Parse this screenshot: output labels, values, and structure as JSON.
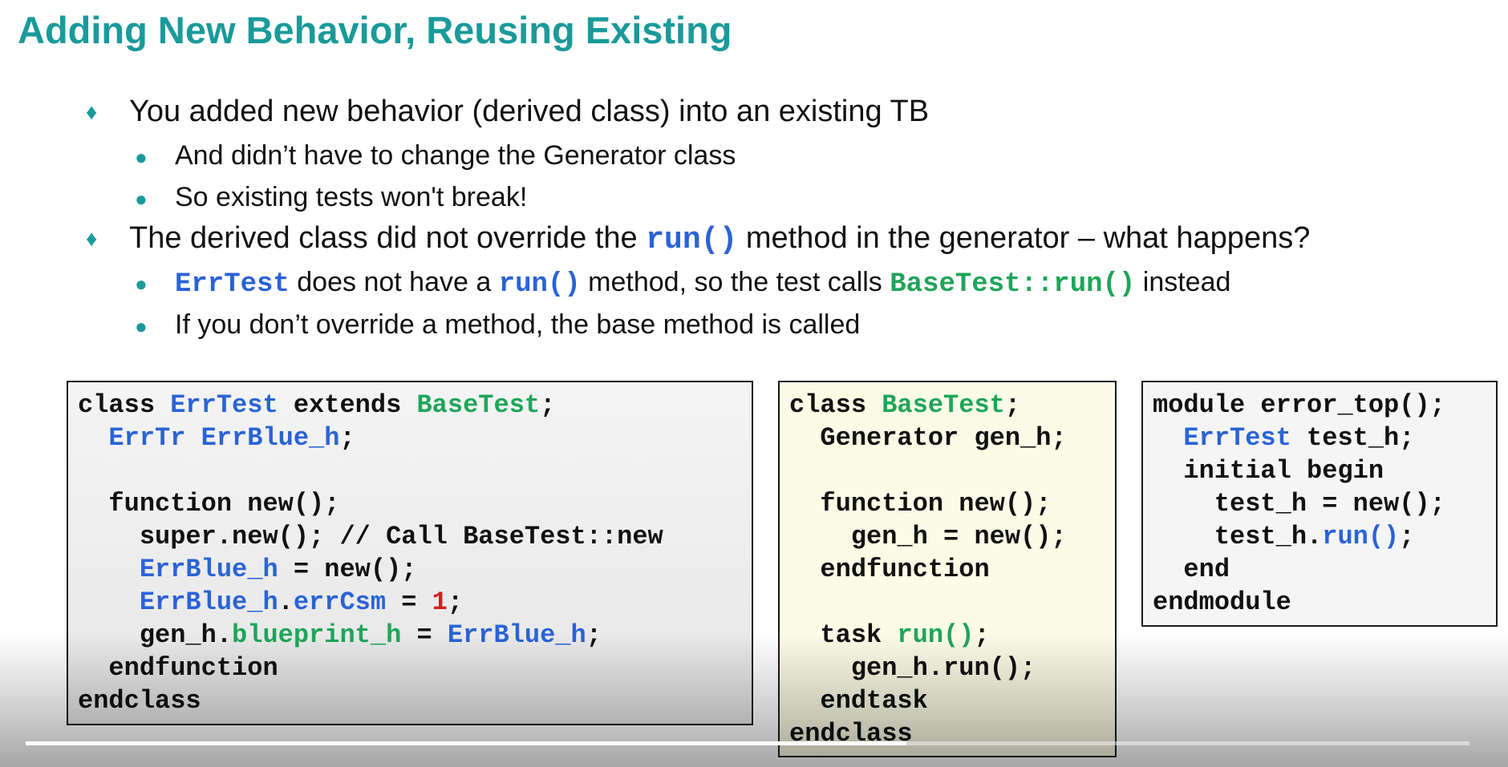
{
  "slide": {
    "title": "Adding New Behavior, Reusing Existing",
    "bullets": {
      "b1": {
        "marker": "♦",
        "text": "You added new behavior (derived class) into an existing TB"
      },
      "b1a": {
        "marker": "●",
        "text": "And didn’t have to change the Generator class"
      },
      "b1b": {
        "marker": "●",
        "text": "So existing tests won't break!"
      },
      "b2": {
        "marker": "♦",
        "pre": "The derived class did not override the ",
        "code": "run()",
        "post": " method in the generator – what happens?"
      },
      "b2a": {
        "marker": "●",
        "code1": "ErrTest",
        "mid1": " does not have a ",
        "code2": "run()",
        "mid2": " method, so the test calls ",
        "code3": "BaseTest::run()",
        "post": " instead"
      },
      "b2b": {
        "marker": "●",
        "text": "If you don’t override a method, the base method is called"
      }
    }
  },
  "code": {
    "errtest": {
      "l1": {
        "a": "class ",
        "b": "ErrTest",
        "c": " extends ",
        "d": "BaseTest",
        "e": ";"
      },
      "l2": {
        "a": "  ",
        "b": "ErrTr ErrBlue_h",
        "c": ";"
      },
      "l3": "",
      "l4": "  function new();",
      "l5": "    super.new(); // Call BaseTest::new",
      "l6": {
        "a": "    ",
        "b": "ErrBlue_h",
        "c": " = new();"
      },
      "l7": {
        "a": "    ",
        "b": "ErrBlue_h",
        "c": ".",
        "d": "errCsm",
        "e": " = ",
        "f": "1",
        "g": ";"
      },
      "l8": {
        "a": "    gen_h.",
        "b": "blueprint_h",
        "c": " = ",
        "d": "ErrBlue_h",
        "e": ";"
      },
      "l9": "  endfunction",
      "l10": "endclass"
    },
    "basetest": {
      "l1": {
        "a": "class ",
        "b": "BaseTest",
        "c": ";"
      },
      "l2": "  Generator gen_h;",
      "l3": "",
      "l4": "  function new();",
      "l5": "    gen_h = new();",
      "l6": "  endfunction",
      "l7": "",
      "l8": {
        "a": "  task ",
        "b": "run()",
        "c": ";"
      },
      "l9": "    gen_h.run();",
      "l10": "  endtask",
      "l11": "endclass"
    },
    "errortop": {
      "l1": "module error_top();",
      "l2": {
        "a": "  ",
        "b": "ErrTest",
        "c": " test_h;"
      },
      "l3": "  initial begin",
      "l4": "    test_h = new();",
      "l5": {
        "a": "    test_h.",
        "b": "run()",
        "c": ";"
      },
      "l6": "  end",
      "l7": "endmodule"
    }
  },
  "player": {
    "progress_fraction": 0.61
  }
}
